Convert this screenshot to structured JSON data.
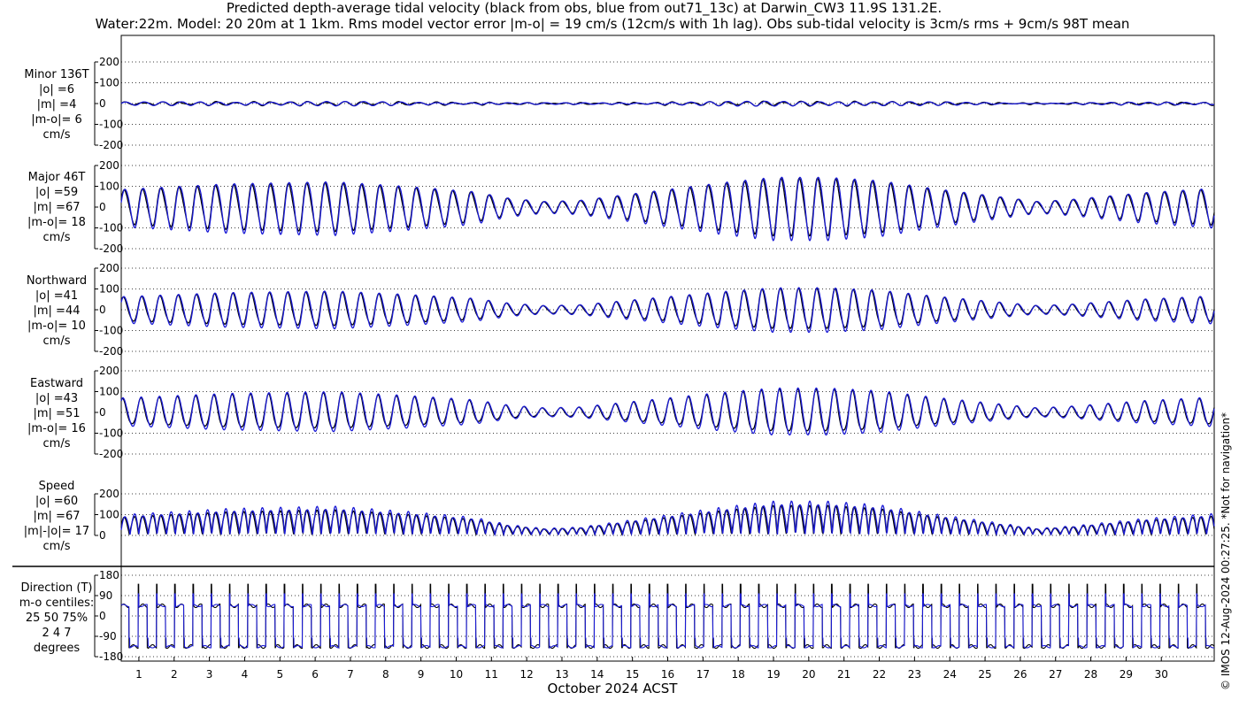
{
  "title_line1": "Predicted depth-average tidal velocity (black from obs, blue from out71_13c) at Darwin_CW3 11.9S 131.2E.",
  "title_line2": "Water:22m. Model: 20 20m at 1 1km. Rms model vector error |m-o| = 19 cm/s (12cm/s with 1h lag). Obs sub-tidal velocity is 3cm/s rms + 9cm/s 98T mean",
  "side_note": "© IMOS 12-Aug-2024 00:27:25. *Not for navigation*",
  "colors": {
    "obs": "#000000",
    "model": "#1a1ad6",
    "grid": "#000000"
  },
  "chart_data": {
    "type": "line",
    "xlabel": "October 2024 ACST",
    "x_tick_labels": [
      "1",
      "2",
      "3",
      "4",
      "5",
      "6",
      "7",
      "8",
      "9",
      "10",
      "11",
      "12",
      "13",
      "14",
      "15",
      "16",
      "17",
      "18",
      "19",
      "20",
      "21",
      "22",
      "23",
      "24",
      "25",
      "26",
      "27",
      "28",
      "29",
      "30"
    ],
    "x_range_days": [
      0,
      31
    ],
    "tidal_period_hours": 12.42,
    "panels": [
      {
        "label_lines": [
          "Minor 136T",
          "|o| =6",
          "|m| =4",
          "|m-o|= 6",
          "cm/s"
        ],
        "ylim": [
          -200,
          200
        ],
        "yticks": [
          -200,
          -100,
          0,
          100,
          200
        ],
        "kind": "component",
        "amp_scale": 0.07,
        "grid": true
      },
      {
        "label_lines": [
          "Major 46T",
          "|o| =59",
          "|m| =67",
          "|m-o|= 18",
          "cm/s"
        ],
        "ylim": [
          -200,
          200
        ],
        "yticks": [
          -200,
          -100,
          0,
          100,
          200
        ],
        "kind": "component",
        "amp_scale": 1.0,
        "grid": true
      },
      {
        "label_lines": [
          "Northward",
          "|o| =41",
          "|m| =44",
          "|m-o|= 10",
          "cm/s"
        ],
        "ylim": [
          -200,
          200
        ],
        "yticks": [
          -200,
          -100,
          0,
          100,
          200
        ],
        "kind": "component",
        "amp_scale": 0.7,
        "grid": true
      },
      {
        "label_lines": [
          "Eastward",
          "|o| =43",
          "|m| =51",
          "|m-o|= 16",
          "cm/s"
        ],
        "ylim": [
          -200,
          200
        ],
        "yticks": [
          -200,
          -100,
          0,
          100,
          200
        ],
        "kind": "component",
        "amp_scale": 0.74,
        "grid": true
      },
      {
        "label_lines": [
          "Speed",
          "|o| =60",
          "|m| =67",
          "|m|-|o|= 17",
          "cm/s"
        ],
        "ylim": [
          0,
          200
        ],
        "yticks": [
          0,
          100,
          200
        ],
        "kind": "speed",
        "amp_scale": 1.0,
        "grid": true
      },
      {
        "label_lines": [
          "Direction (T)",
          "m-o centiles:",
          "25  50  75%",
          "2   4   7",
          "degrees"
        ],
        "ylim": [
          -180,
          180
        ],
        "yticks": [
          -180,
          -90,
          0,
          90,
          180
        ],
        "kind": "direction",
        "grid": true
      }
    ],
    "envelope_day_amplitude": [
      [
        0,
        80
      ],
      [
        3,
        105
      ],
      [
        6,
        115
      ],
      [
        8,
        95
      ],
      [
        10,
        70
      ],
      [
        11,
        40
      ],
      [
        12,
        25
      ],
      [
        13,
        30
      ],
      [
        15,
        70
      ],
      [
        17,
        110
      ],
      [
        18.5,
        135
      ],
      [
        20,
        135
      ],
      [
        21.5,
        120
      ],
      [
        23,
        85
      ],
      [
        24.5,
        55
      ],
      [
        26,
        25
      ],
      [
        27,
        35
      ],
      [
        29,
        65
      ],
      [
        31,
        85
      ]
    ]
  }
}
